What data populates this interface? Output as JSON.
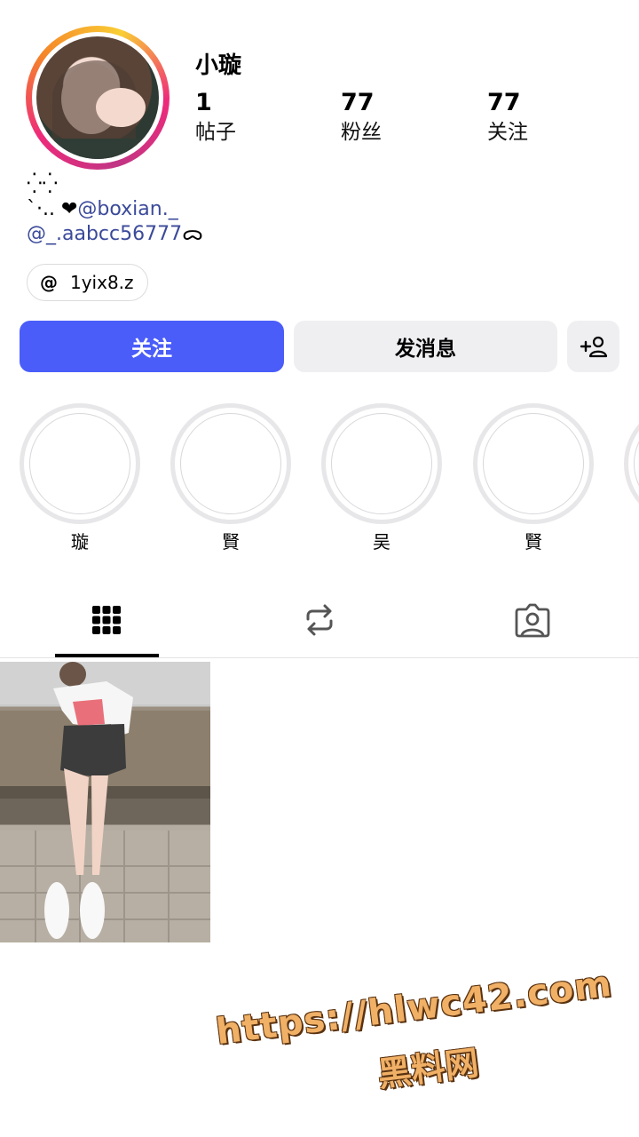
{
  "profile": {
    "username": "小璇",
    "stats": [
      {
        "value": "1",
        "label": "帖子"
      },
      {
        "value": "77",
        "label": "粉丝"
      },
      {
        "value": "77",
        "label": "关注"
      }
    ],
    "bio": {
      "line1": "⁛⁛",
      "line2_prefix": "`·.. ❤",
      "line2_link": "@boxian._",
      "line3_link": "@_.aabcc56777",
      "line3_suffix": "ᯅ"
    },
    "threads_handle": "1yix8.z"
  },
  "actions": {
    "follow_label": "关注",
    "message_label": "发消息",
    "add_user_icon": "add-person-icon"
  },
  "highlights": [
    {
      "label": "璇"
    },
    {
      "label": "賢"
    },
    {
      "label": "吴"
    },
    {
      "label": "賢"
    },
    {
      "label": ""
    }
  ],
  "tabs": [
    "grid-icon",
    "repost-icon",
    "tagged-icon"
  ],
  "watermark": {
    "url": "https://hlwc42.com",
    "site": "黑料网"
  },
  "colors": {
    "accent": "#4a5df9",
    "secondary_button": "#efeff2",
    "link": "#3b4a9a"
  }
}
